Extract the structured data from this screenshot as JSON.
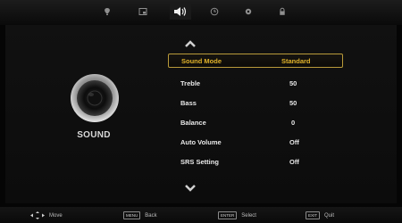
{
  "menu_tabs": [
    {
      "icon": "picture-icon",
      "active": false
    },
    {
      "icon": "screen-icon",
      "active": false
    },
    {
      "icon": "speaker-icon",
      "active": true
    },
    {
      "icon": "clock-icon",
      "active": false
    },
    {
      "icon": "gear-icon",
      "active": false
    },
    {
      "icon": "lock-icon",
      "active": false
    }
  ],
  "section": {
    "title": "SOUND",
    "icon": "speaker-icon"
  },
  "settings": [
    {
      "label": "Sound Mode",
      "value": "Standard",
      "selected": true
    },
    {
      "label": "Treble",
      "value": "50",
      "selected": false
    },
    {
      "label": "Bass",
      "value": "50",
      "selected": false
    },
    {
      "label": "Balance",
      "value": "0",
      "selected": false
    },
    {
      "label": "Auto Volume",
      "value": "Off",
      "selected": false
    },
    {
      "label": "SRS Setting",
      "value": "Off",
      "selected": false
    }
  ],
  "footer": {
    "move": "Move",
    "back_key": "MENU",
    "back": "Back",
    "select_key": "ENTER",
    "select": "Select",
    "quit_key": "EXIT",
    "quit": "Quit"
  },
  "colors": {
    "accent": "#e0b22a",
    "background": "#050505"
  }
}
